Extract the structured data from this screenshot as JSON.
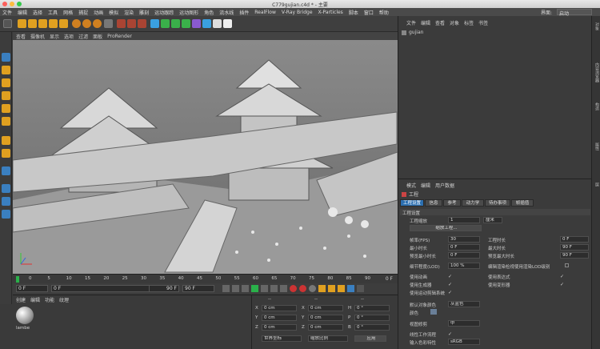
{
  "window": {
    "title": "C779gujian.c4d * - 主要"
  },
  "menubar": {
    "items": [
      "文件",
      "编辑",
      "选择",
      "工具",
      "网格",
      "捕捉",
      "动画",
      "模拟",
      "渲染",
      "雕刻",
      "运动跟踪",
      "运动图形",
      "角色",
      "流水线",
      "插件",
      "RealFlow",
      "V-Ray Bridge",
      "X-Particles",
      "脚本",
      "窗口",
      "帮助"
    ],
    "layout_label": "界面:",
    "layout_value": "启动"
  },
  "viewport": {
    "menu": [
      "查看",
      "摄像机",
      "显示",
      "选项",
      "过滤",
      "面板",
      "ProRender"
    ]
  },
  "timeline": {
    "ticks": [
      "0",
      "5",
      "10",
      "15",
      "20",
      "25",
      "30",
      "35",
      "40",
      "45",
      "50",
      "55",
      "60",
      "65",
      "70",
      "75",
      "80",
      "85",
      "90"
    ],
    "end_label": "0 F"
  },
  "transport": {
    "start": "0 F",
    "current": "0 F",
    "end": "90 F",
    "end2": "90 F"
  },
  "materials": {
    "menu": [
      "创建",
      "编辑",
      "功能",
      "纹理"
    ],
    "ball_label": "lambe"
  },
  "coords": {
    "headers": [
      "--",
      "--",
      "--"
    ],
    "rows": [
      {
        "axis": "X",
        "pos": "0 cm",
        "axis2": "X",
        "size": "0 cm",
        "axis3": "H",
        "rot": "0 °"
      },
      {
        "axis": "Y",
        "pos": "0 cm",
        "axis2": "Y",
        "size": "0 cm",
        "axis3": "P",
        "rot": "0 °"
      },
      {
        "axis": "Z",
        "pos": "0 cm",
        "axis2": "Z",
        "size": "0 cm",
        "axis3": "B",
        "rot": "0 °"
      }
    ],
    "mode1": "世界坐标",
    "mode2": "缩放比例",
    "apply": "应用"
  },
  "objects": {
    "menu": [
      "文件",
      "编辑",
      "查看",
      "对象",
      "标签",
      "书签"
    ],
    "root": "gujian"
  },
  "attributes": {
    "menu": [
      "模式",
      "编辑",
      "用户数据"
    ],
    "header": "工程",
    "tabs": [
      "工程设置",
      "信息",
      "参考",
      "动力学",
      "待办事项",
      "帧插值"
    ],
    "section": "工程设置",
    "scale_label": "工程缩放",
    "scale_value": "1",
    "scale_unit": "厘米",
    "scale_button": "缩放工程...",
    "fps_label": "帧率(FPS)",
    "fps_value": "30",
    "projtime_label": "工程时长",
    "projtime_value": "0 F",
    "mintime_label": "最小时长",
    "mintime_value": "0 F",
    "maxtime_label": "最大时长",
    "maxtime_value": "90 F",
    "prevmin_label": "预览最小时长",
    "prevmin_value": "0 F",
    "prevmax_label": "预览最大时长",
    "prevmax_value": "90 F",
    "lod_label": "细节程度(LOD)",
    "lod_value": "100 %",
    "lodrender_label": "编辑渲染检视使用渲染LOD级别",
    "useanim_label": "使用动画",
    "useexpr_label": "使用表达式",
    "usegen_label": "使用生成器",
    "usedeform_label": "使用变形器",
    "usemotion_label": "使用运动剪辑系统",
    "defcolor_label": "默认对象颜色",
    "defcolor_value": "灰蓝色",
    "color_label": "颜色",
    "viewclip_label": "视图修剪",
    "viewclip_value": "中",
    "linear_label": "线性工作流程",
    "inputcolor_label": "输入色彩特性",
    "inputcolor_value": "sRGB"
  },
  "rightstrip": {
    "tabs": [
      "对象",
      "内容浏览器",
      "构造",
      "属性",
      "层"
    ]
  },
  "colors": {
    "accent": "#2c6fb0",
    "bg": "#3a3a3a",
    "viewport": "#6e6e6e"
  }
}
